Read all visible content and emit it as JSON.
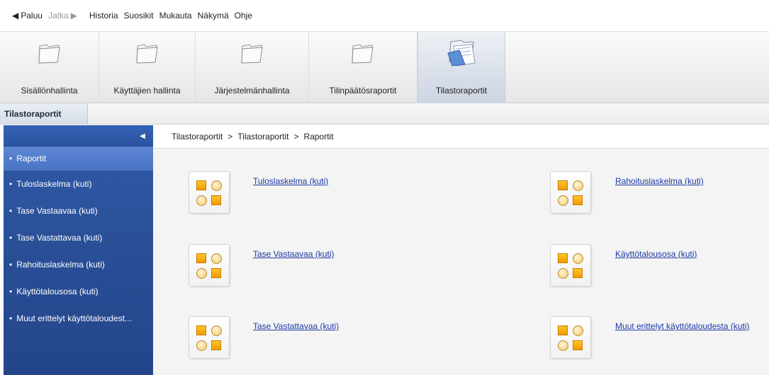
{
  "menubar": {
    "back_label": "Paluu",
    "forward_label": "Jatka",
    "items": [
      "Historia",
      "Suosikit",
      "Mukauta",
      "Näkymä",
      "Ohje"
    ]
  },
  "toolbar": {
    "buttons": [
      {
        "label": "Sisällönhallinta",
        "icon": "folder-icon"
      },
      {
        "label": "Käyttäjien hallinta",
        "icon": "folder-icon"
      },
      {
        "label": "Järjestelmänhallinta",
        "icon": "folder-icon"
      },
      {
        "label": "Tilinpäätösraportit",
        "icon": "folder-icon"
      },
      {
        "label": "Tilastoraportit",
        "icon": "reports-icon",
        "active": true
      }
    ]
  },
  "section": {
    "title": "Tilastoraportit"
  },
  "sidebar": {
    "collapse_icon": "collapse-left-icon",
    "items": [
      {
        "label": "Raportit",
        "selected": true
      },
      {
        "label": "Tuloslaskelma (kuti)"
      },
      {
        "label": "Tase Vastaavaa (kuti)"
      },
      {
        "label": "Tase Vastattavaa (kuti)"
      },
      {
        "label": "Rahoituslaskelma (kuti)"
      },
      {
        "label": "Käyttötalousosa (kuti)"
      },
      {
        "label": "Muut erittelyt käyttötaloudest..."
      }
    ]
  },
  "breadcrumb": {
    "items": [
      "Tilastoraportit",
      "Tilastoraportit",
      "Raportit"
    ],
    "separator": ">"
  },
  "reports": [
    {
      "label": "Tuloslaskelma (kuti)",
      "icon": "report-icon"
    },
    {
      "label": "Rahoituslaskelma (kuti)",
      "icon": "report-icon"
    },
    {
      "label": "Tase Vastaavaa (kuti)",
      "icon": "report-icon"
    },
    {
      "label": "Käyttötalousosa (kuti)",
      "icon": "report-icon"
    },
    {
      "label": "Tase Vastattavaa (kuti)",
      "icon": "report-icon"
    },
    {
      "label": "Muut erittelyt käyttötaloudesta (kuti)",
      "icon": "report-icon"
    }
  ],
  "colors": {
    "sidebar_bg": "#2a4f97",
    "sidebar_selected": "#4a74c4",
    "link": "#1c3aa5",
    "accent_orange": "#f39a00"
  }
}
